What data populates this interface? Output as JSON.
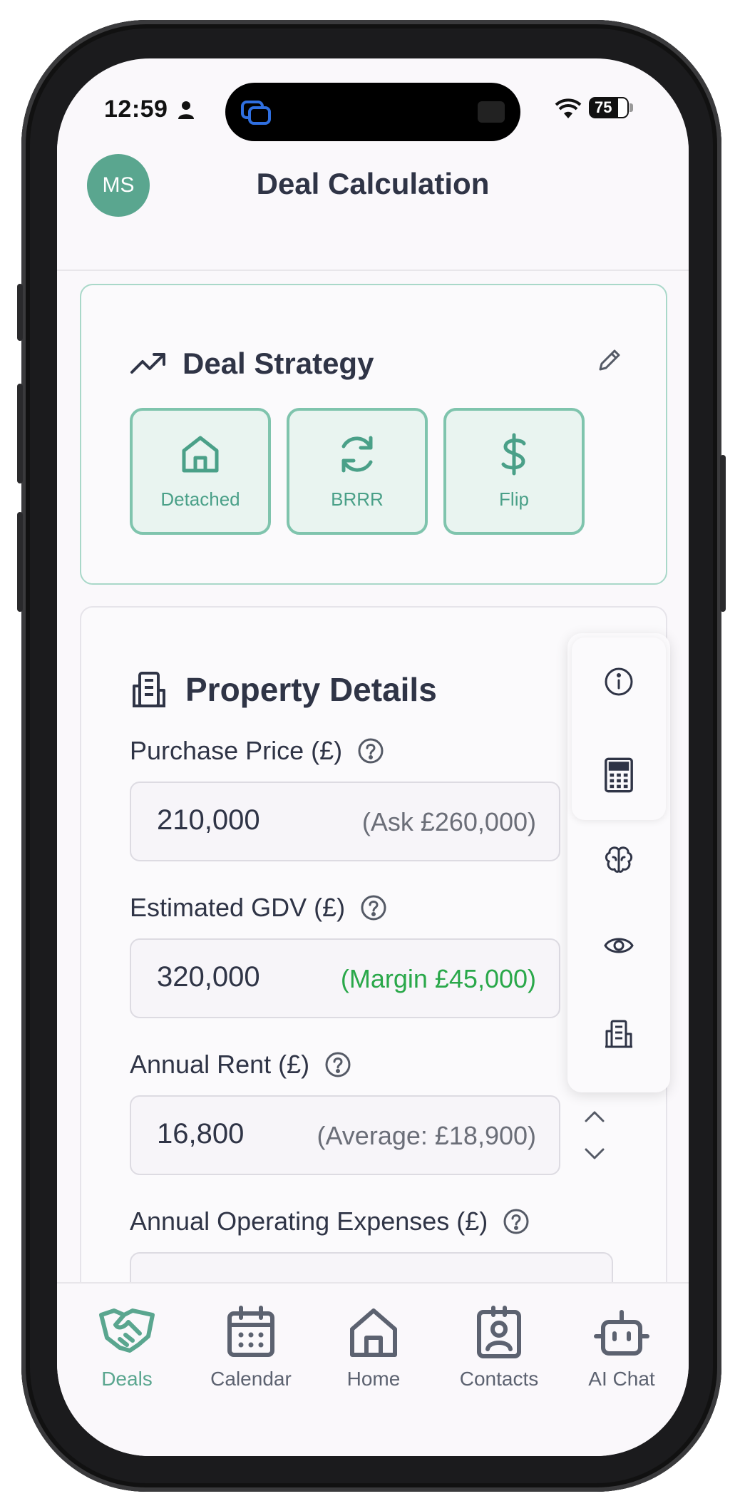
{
  "status_bar": {
    "time": "12:59",
    "battery": "75",
    "battery_level": 0.75
  },
  "header": {
    "avatar_initials": "MS",
    "title": "Deal Calculation"
  },
  "deal_strategy": {
    "title": "Deal Strategy",
    "options": [
      {
        "label": "Detached",
        "icon": "house-icon"
      },
      {
        "label": "BRRR",
        "icon": "refresh-icon"
      },
      {
        "label": "Flip",
        "icon": "dollar-icon"
      }
    ]
  },
  "property_details": {
    "title": "Property Details",
    "fields": [
      {
        "label": "Purchase Price (£)",
        "value": "210,000",
        "hint": "(Ask £260,000)"
      },
      {
        "label": "Estimated GDV (£)",
        "value": "320,000",
        "hint": "(Margin £45,000)"
      },
      {
        "label": "Annual Rent (£)",
        "value": "16,800",
        "hint": "(Average: £18,900)"
      },
      {
        "label": "Annual Operating Expenses (£)"
      }
    ]
  },
  "side_panel": {
    "icons": [
      "info-icon",
      "calculator-icon",
      "brain-icon",
      "eye-icon",
      "building-icon"
    ]
  },
  "tabs": [
    {
      "label": "Deals",
      "icon": "handshake-icon",
      "active": true
    },
    {
      "label": "Calendar",
      "icon": "calendar-icon"
    },
    {
      "label": "Home",
      "icon": "home-icon"
    },
    {
      "label": "Contacts",
      "icon": "contacts-icon"
    },
    {
      "label": "AI Chat",
      "icon": "robot-icon"
    }
  ],
  "colors": {
    "accent": "#5aa68f",
    "text": "#2f3446",
    "positive": "#2aa84a"
  }
}
